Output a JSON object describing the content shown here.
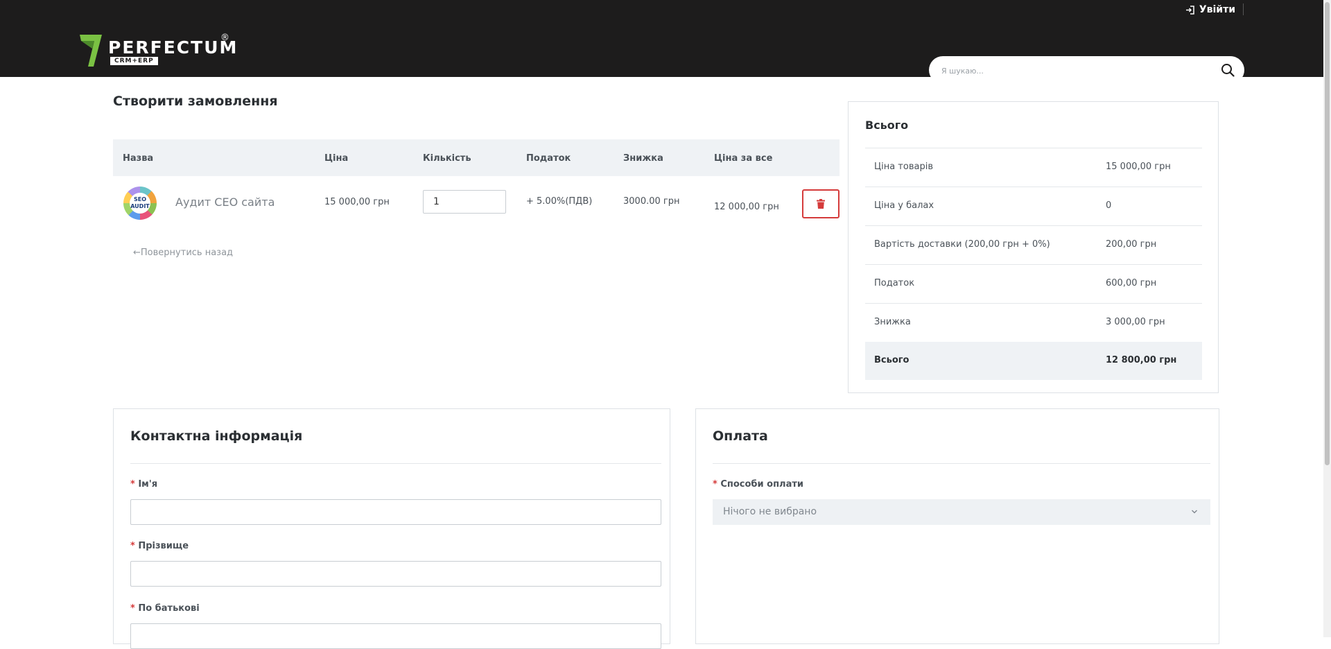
{
  "topbar": {
    "login_label": "Увійти"
  },
  "header": {
    "logo_text": "PERFECTUM",
    "logo_sub": "CRM+ERP",
    "logo_mark": "®",
    "search_placeholder": "Я шукаю..."
  },
  "page": {
    "title": "Створити замовлення",
    "back_label": "Повернутись назад"
  },
  "table": {
    "headers": [
      "Назва",
      "Ціна",
      "Кількість",
      "Податок",
      "Знижка",
      "Ціна за все"
    ],
    "rows": [
      {
        "image_caption": "SEO AUDIT",
        "name": "Аудит СЕО сайта",
        "price": "15 000,00 грн",
        "quantity": "1",
        "tax": "+ 5.00%(ПДВ)",
        "discount": "3000.00 грн",
        "total": "12 000,00 грн"
      }
    ]
  },
  "summary": {
    "title": "Всього",
    "rows": [
      {
        "label": "Ціна товарів",
        "value": "15 000,00 грн"
      },
      {
        "label": "Ціна у балах",
        "value": "0"
      },
      {
        "label": "Вартість доставки (200,00 грн + 0%)",
        "value": "200,00 грн"
      },
      {
        "label": "Податок",
        "value": "600,00 грн"
      },
      {
        "label": "Знижка",
        "value": "3 000,00 грн"
      }
    ],
    "total": {
      "label": "Всього",
      "value": "12 800,00 грн"
    }
  },
  "contact": {
    "title": "Контактна інформація",
    "fields": [
      {
        "label": "Ім'я",
        "required": "*"
      },
      {
        "label": "Прізвище",
        "required": "*"
      },
      {
        "label": "По батькові",
        "required": "*"
      }
    ]
  },
  "payment": {
    "title": "Оплата",
    "method_label": "Способи оплати",
    "required": "*",
    "method_value": "Нічого не вибрано"
  },
  "colors": {
    "header_bg": "#1d1c1c",
    "logo_green": "#7ac143",
    "danger": "#d53b3b",
    "table_head_bg": "#eff2f5"
  }
}
